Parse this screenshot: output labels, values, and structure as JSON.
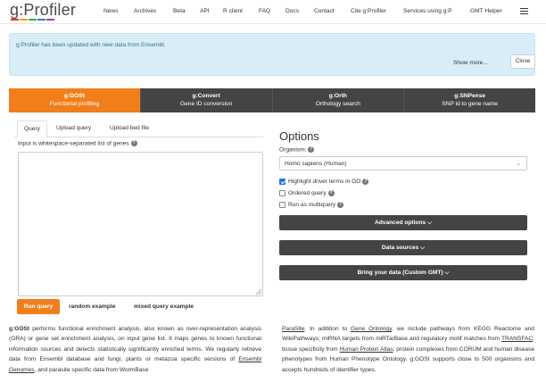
{
  "navbar": {
    "logo": "g:Profiler",
    "logo_colors": [
      "#e8332a",
      "#f0a30a",
      "#3aa856",
      "#2a7fd4",
      "#8e44ad"
    ],
    "links": [
      "News",
      "Archives",
      "Beta",
      "API",
      "R client",
      "FAQ",
      "Docs",
      "Contact",
      "Cite g:Profiler",
      "Services using g:P",
      "GMT Helper"
    ],
    "menu_icon": "hamburger-icon"
  },
  "alert": {
    "text": "g:Profiler has been updated with new data from Ensembl.",
    "show_more": "Show more...",
    "close": "Close"
  },
  "tools": [
    {
      "name": "g:GOSt",
      "desc": "Functional profiling",
      "active": true
    },
    {
      "name": "g:Convert",
      "desc": "Gene ID conversion",
      "active": false
    },
    {
      "name": "g:Orth",
      "desc": "Orthology search",
      "active": false
    },
    {
      "name": "g:SNPense",
      "desc": "SNP id to gene name",
      "active": false
    }
  ],
  "input_tabs": [
    "Query",
    "Upload query",
    "Upload bed file"
  ],
  "input": {
    "label": "Input is whitespace-separated list of genes",
    "value": ""
  },
  "buttons": {
    "run": "Run query",
    "random": "random example",
    "mixed": "mixed query example"
  },
  "options": {
    "title": "Options",
    "organism_label": "Organism:",
    "organism": "Homo sapiens (Human)",
    "checkboxes": [
      {
        "label": "Highlight driver terms in GO",
        "checked": true
      },
      {
        "label": "Ordered query",
        "checked": false
      },
      {
        "label": "Run as multiquery",
        "checked": false
      }
    ],
    "advanced": "Advanced options",
    "sources": "Data sources",
    "custom": "Bring your data (Custom GMT)"
  },
  "description": {
    "left": [
      "g:GOSt",
      " performs functional enrichment analysis, also known as over-representation analysis (ORA) or gene set enrichment analysis, on input gene list. It maps genes to known functional information sources and detects statistically significantly enriched terms. We regularly retrieve data from Ensembl database and fungi, plants or metazoa specific versions of ",
      "Ensembl Genomes",
      ", and parasite specific data from WormBase"
    ],
    "right": [
      "ParaSite",
      ". In addition to ",
      "Gene Ontology",
      ", we include pathways from KEGG Reactome and WikiPathways; miRNA targets from miRTarBase and regulatory motif matches from ",
      "TRANSFAC",
      "; tissue specificity from ",
      "Human Protein Atlas",
      "; protein complexes from CORUM and human disease phenotypes from Human Phenotype Ontology. g:GOSt supports close to 500 organisms and accepts hundreds of identifier types."
    ]
  }
}
